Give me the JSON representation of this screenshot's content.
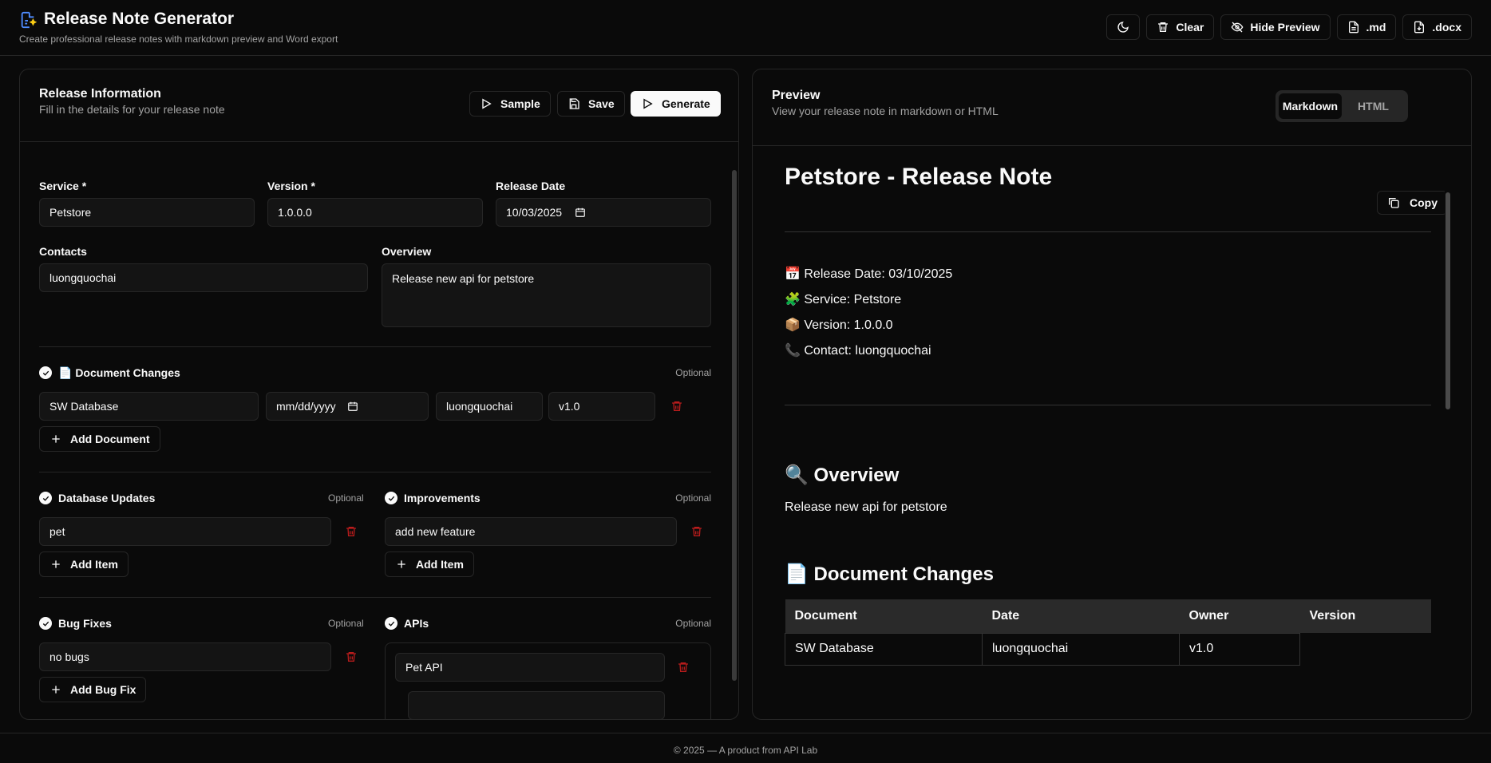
{
  "header": {
    "title": "Release Note Generator",
    "subtitle": "Create professional release notes with markdown preview and Word export",
    "buttons": {
      "theme": "",
      "clear": "Clear",
      "hide_preview": "Hide Preview",
      "md": ".md",
      "docx": ".docx"
    }
  },
  "form": {
    "title": "Release Information",
    "subtitle": "Fill in the details for your release note",
    "buttons": {
      "sample": "Sample",
      "save": "Save",
      "generate": "Generate"
    },
    "fields": {
      "service_label": "Service *",
      "service_value": "Petstore",
      "version_label": "Version *",
      "version_value": "1.0.0.0",
      "date_label": "Release Date",
      "date_value": "10/03/2025",
      "contacts_label": "Contacts",
      "contacts_value": "luongquochai",
      "overview_label": "Overview",
      "overview_value": "Release new api for petstore"
    },
    "document_changes": {
      "title": "📄 Document Changes",
      "optional": "Optional",
      "row": {
        "name": "SW Database",
        "date": "mm/dd/yyyy",
        "owner": "luongquochai",
        "version": "v1.0"
      },
      "add_label": "Add Document"
    },
    "database_updates": {
      "title": "Database Updates",
      "optional": "Optional",
      "item": "pet",
      "add_label": "Add Item"
    },
    "improvements": {
      "title": "Improvements",
      "optional": "Optional",
      "item": "add new feature",
      "add_label": "Add Item"
    },
    "bug_fixes": {
      "title": "Bug Fixes",
      "optional": "Optional",
      "item": "no bugs",
      "add_label": "Add Bug Fix"
    },
    "apis": {
      "title": "APIs",
      "optional": "Optional",
      "item": "Pet API"
    }
  },
  "preview": {
    "title": "Preview",
    "subtitle": "View your release note in markdown or HTML",
    "tabs": [
      "Markdown",
      "HTML"
    ],
    "active_tab": "Markdown",
    "copy_label": "Copy",
    "doc": {
      "heading": "Petstore - Release Note",
      "meta": [
        "📅 Release Date: 03/10/2025",
        "🧩 Service: Petstore",
        "📦 Version: 1.0.0.0",
        "📞 Contact: luongquochai"
      ],
      "overview_heading": "🔍 Overview",
      "overview_text": "Release new api for petstore",
      "doc_changes_heading": "📄 Document Changes",
      "table": {
        "headers": [
          "Document",
          "Date",
          "Owner",
          "Version"
        ],
        "rows": [
          [
            "SW Database",
            "luongquochai",
            "v1.0",
            ""
          ]
        ]
      }
    }
  },
  "footer": "© 2025 — A product from API Lab",
  "colors": {
    "background": "#0a0a0a",
    "border": "#262626",
    "danger": "#b91c1c",
    "muted": "#a3a3a3"
  }
}
